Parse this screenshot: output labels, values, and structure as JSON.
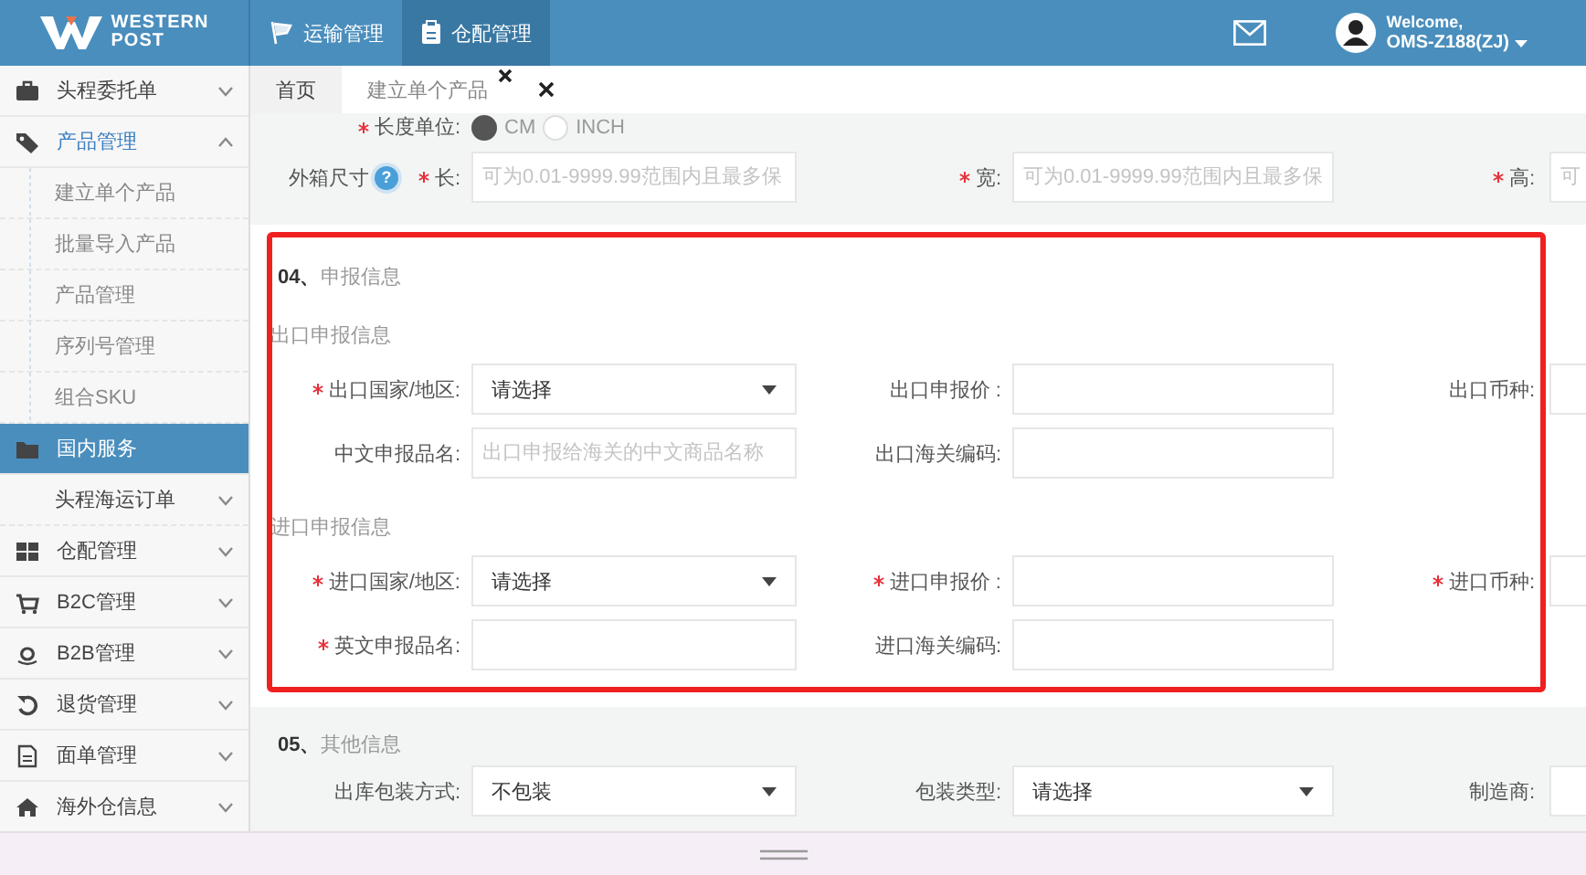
{
  "header": {
    "logo_lines": [
      "WESTERN",
      "POST"
    ],
    "nav": [
      {
        "label": "运输管理",
        "selected": false
      },
      {
        "label": "仓配管理",
        "selected": true
      }
    ],
    "user": {
      "greeting": "Welcome,",
      "name": "OMS-Z188(ZJ)"
    }
  },
  "sidebar": {
    "items": [
      {
        "label": "头程委托单",
        "kind": "group",
        "expanded": false,
        "selected": false
      },
      {
        "label": "产品管理",
        "kind": "group",
        "expanded": true,
        "selected": false,
        "children": [
          {
            "label": "建立单个产品",
            "kind": "leaf",
            "selected": false
          },
          {
            "label": "批量导入产品",
            "kind": "leaf",
            "selected": false
          },
          {
            "label": "产品管理",
            "kind": "leaf",
            "selected": false
          },
          {
            "label": "序列号管理",
            "kind": "leaf",
            "selected": false
          },
          {
            "label": "组合SKU",
            "kind": "leaf",
            "selected": false
          }
        ]
      },
      {
        "label": "国内服务",
        "kind": "section",
        "expanded": true,
        "selected": true,
        "children": [
          {
            "label": "头程海运订单",
            "kind": "group",
            "expanded": false,
            "selected": false
          }
        ]
      },
      {
        "label": "仓配管理",
        "kind": "group",
        "expanded": false,
        "selected": false
      },
      {
        "label": "B2C管理",
        "kind": "group",
        "expanded": false,
        "selected": false
      },
      {
        "label": "B2B管理",
        "kind": "group",
        "expanded": false,
        "selected": false
      },
      {
        "label": "退货管理",
        "kind": "group",
        "expanded": false,
        "selected": false
      },
      {
        "label": "面单管理",
        "kind": "group",
        "expanded": false,
        "selected": false
      },
      {
        "label": "海外仓信息",
        "kind": "group",
        "expanded": false,
        "selected": false
      }
    ]
  },
  "tabs": [
    {
      "label": "首页",
      "selected": false,
      "closable": false
    },
    {
      "label": "建立单个产品",
      "selected": true,
      "closable": true
    }
  ],
  "length_unit": {
    "label": "长度单位:",
    "required": true,
    "options": [
      {
        "label": "CM",
        "selected": true
      },
      {
        "label": "INCH",
        "selected": false
      }
    ]
  },
  "carton_size": {
    "label": "外箱尺寸",
    "help": "?",
    "fields": [
      {
        "label": "长:",
        "required": true,
        "kind": "input",
        "placeholder": "可为0.01-9999.99范围内且最多保"
      },
      {
        "label": "宽:",
        "required": true,
        "kind": "input",
        "placeholder": "可为0.01-9999.99范围内且最多保"
      },
      {
        "label": "高:",
        "required": true,
        "kind": "input",
        "placeholder": "可"
      }
    ]
  },
  "declaration": {
    "number": "04、",
    "title": "申报信息",
    "groups": [
      {
        "heading": "出口申报信息",
        "rows": [
          [
            {
              "label": "出口国家/地区:",
              "required": true,
              "kind": "select",
              "value": "请选择"
            },
            {
              "label": "出口申报价 :",
              "required": false,
              "kind": "input"
            },
            {
              "label": "出口币种:",
              "required": false,
              "kind": "input"
            }
          ],
          [
            {
              "label": "中文申报品名:",
              "required": false,
              "kind": "input",
              "placeholder": "出口申报给海关的中文商品名称"
            },
            {
              "label": "出口海关编码:",
              "required": false,
              "kind": "input"
            }
          ]
        ]
      },
      {
        "heading": "进口申报信息",
        "rows": [
          [
            {
              "label": "进口国家/地区:",
              "required": true,
              "kind": "select",
              "value": "请选择"
            },
            {
              "label": "进口申报价 :",
              "required": true,
              "kind": "input"
            },
            {
              "label": "进口币种:",
              "required": true,
              "kind": "input"
            }
          ],
          [
            {
              "label": "英文申报品名:",
              "required": true,
              "kind": "input"
            },
            {
              "label": "进口海关编码:",
              "required": false,
              "kind": "input"
            }
          ]
        ]
      }
    ]
  },
  "other": {
    "number": "05、",
    "title": "其他信息",
    "rows": [
      [
        {
          "label": "出库包装方式:",
          "required": false,
          "kind": "select",
          "value": "不包装"
        },
        {
          "label": "包装类型:",
          "required": false,
          "kind": "select",
          "value": "请选择"
        },
        {
          "label": "制造商:",
          "required": false,
          "kind": "input"
        }
      ]
    ]
  }
}
